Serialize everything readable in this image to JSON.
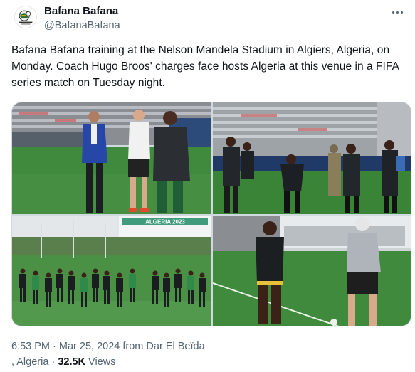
{
  "account": {
    "display_name": "Bafana Bafana",
    "handle": "@BafanaBafana",
    "avatar_icon": "safa-crest-icon"
  },
  "tweet": {
    "text": "Bafana Bafana training at the Nelson Mandela Stadium in Algiers, Algeria, on Monday. Coach Hugo Broos' charges face hosts Algeria at this venue in a FIFA series match on Tuesday night."
  },
  "media": {
    "photo_count": 4,
    "photos": [
      {
        "name": "photo-coaches-stadium"
      },
      {
        "name": "photo-players-stands"
      },
      {
        "name": "photo-team-running",
        "sign_text": "ALGERIA 2023"
      },
      {
        "name": "photo-coach-ball"
      }
    ]
  },
  "meta": {
    "time": "6:53 PM",
    "separator": "·",
    "date": "Mar 25, 2024",
    "location_prefix": "from",
    "location_line1": "Dar El Beïda",
    "location_line2": ", Algeria",
    "views_count": "32.5K",
    "views_label": "Views"
  },
  "colors": {
    "text": "#0f1419",
    "secondary": "#536471",
    "border": "#cfd9de",
    "pitch_green": "#3f8a3c"
  }
}
